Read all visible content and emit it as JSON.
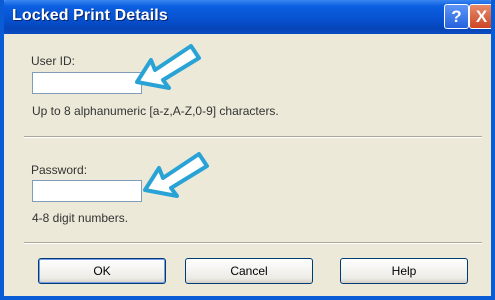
{
  "window": {
    "title": "Locked Print Details",
    "help_glyph": "?",
    "close_glyph": "X"
  },
  "user_id": {
    "label": "User ID:",
    "value": "",
    "hint": "Up to 8 alphanumeric [a-z,A-Z,0-9] characters."
  },
  "password": {
    "label": "Password:",
    "value": "",
    "hint": "4-8 digit numbers."
  },
  "buttons": {
    "ok": "OK",
    "cancel": "Cancel",
    "help": "Help"
  },
  "colors": {
    "title_bar": "#0752d1",
    "dialog_bg": "#ece9d8",
    "arrow": "#29a3d6"
  },
  "annotations": {
    "arrow_icon": "arrow-pointing-left-down"
  }
}
